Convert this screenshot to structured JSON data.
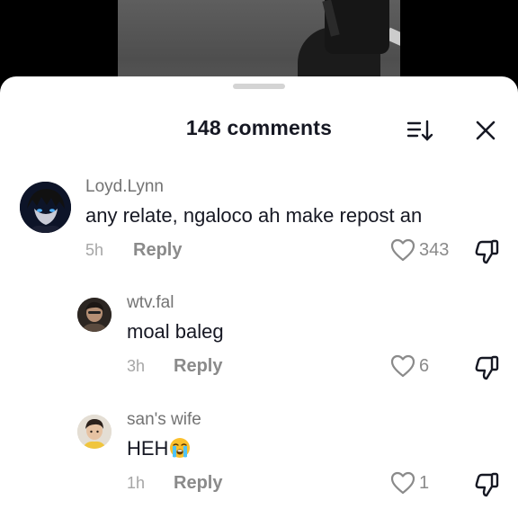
{
  "header": {
    "title": "148 comments"
  },
  "comments": [
    {
      "username": "Loyd.Lynn",
      "text": "any relate, ngaloco ah make repost an",
      "time": "5h",
      "reply_label": "Reply",
      "likes": "343"
    },
    {
      "username": "wtv.fal",
      "text": "moal baleg",
      "time": "3h",
      "reply_label": "Reply",
      "likes": "6"
    },
    {
      "username": "san's wife",
      "text": "HEH",
      "time": "1h",
      "reply_label": "Reply",
      "likes": "1"
    }
  ],
  "icons": {
    "sort": "sort-icon",
    "close": "close-icon",
    "like": "heart-outline-icon",
    "dislike": "thumbs-down-icon",
    "emoji": "loudly-crying-face-emoji"
  }
}
